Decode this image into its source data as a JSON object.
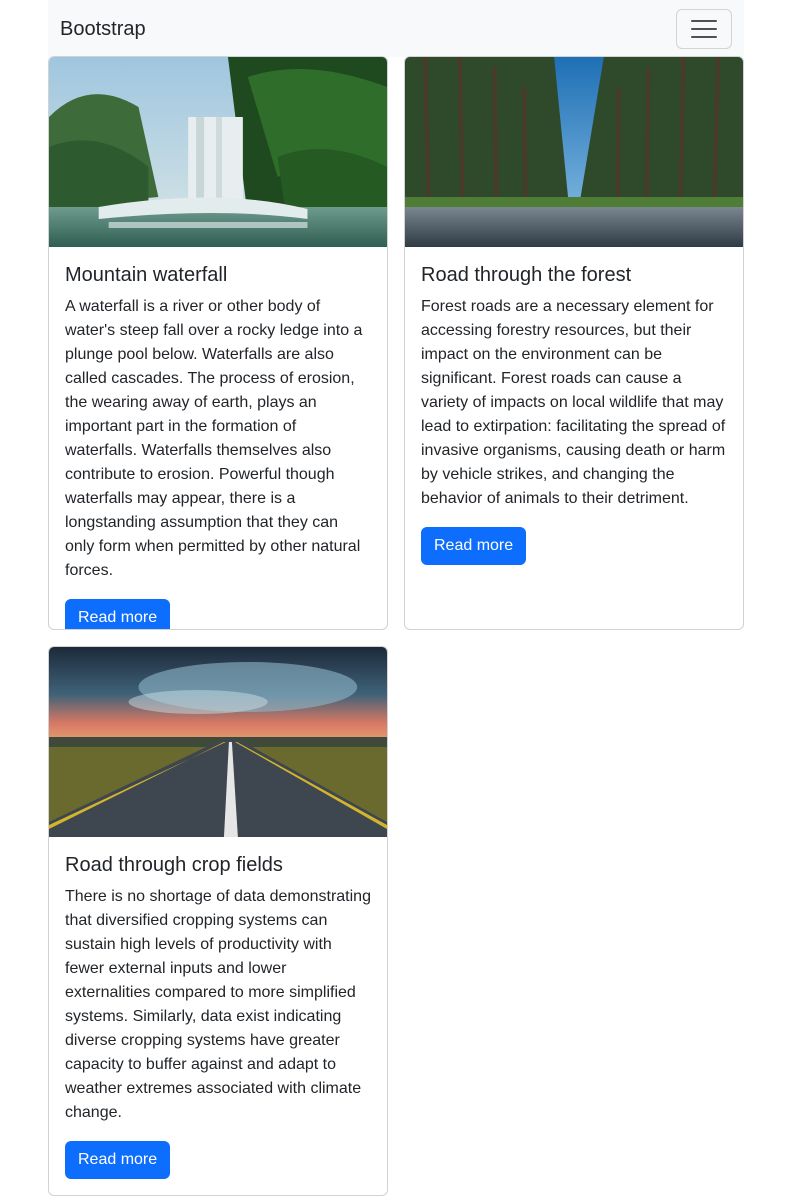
{
  "navbar": {
    "brand": "Bootstrap",
    "toggler_icon": "hamburger-menu-icon"
  },
  "cards": [
    {
      "title": "Mountain waterfall",
      "text": "A waterfall is a river or other body of water's steep fall over a rocky ledge into a plunge pool below. Waterfalls are also called cascades. The process of erosion, the wearing away of earth, plays an important part in the formation of waterfalls. Waterfalls themselves also contribute to erosion. Powerful though waterfalls may appear, there is a longstanding assumption that they can only form when permitted by other natural forces.",
      "button": "Read more"
    },
    {
      "title": "Road through the forest",
      "text": "Forest roads are a necessary element for accessing forestry resources, but their impact on the environment can be significant. Forest roads can cause a variety of impacts on local wildlife that may lead to extirpation: facilitating the spread of invasive organisms, causing death or harm by vehicle strikes, and changing the behavior of animals to their detriment.",
      "button": "Read more"
    },
    {
      "title": "Road through crop fields",
      "text": "There is no shortage of data demonstrating that diversified cropping systems can sustain high levels of productivity with fewer external inputs and lower externalities compared to more simplified systems. Similarly, data exist indicating diverse cropping systems have greater capacity to buffer against and adapt to weather extremes associated with climate change.",
      "button": "Read more"
    }
  ],
  "colors": {
    "primary": "#0d6efd",
    "navbar_bg": "#f8f9fa",
    "text": "#212529"
  }
}
